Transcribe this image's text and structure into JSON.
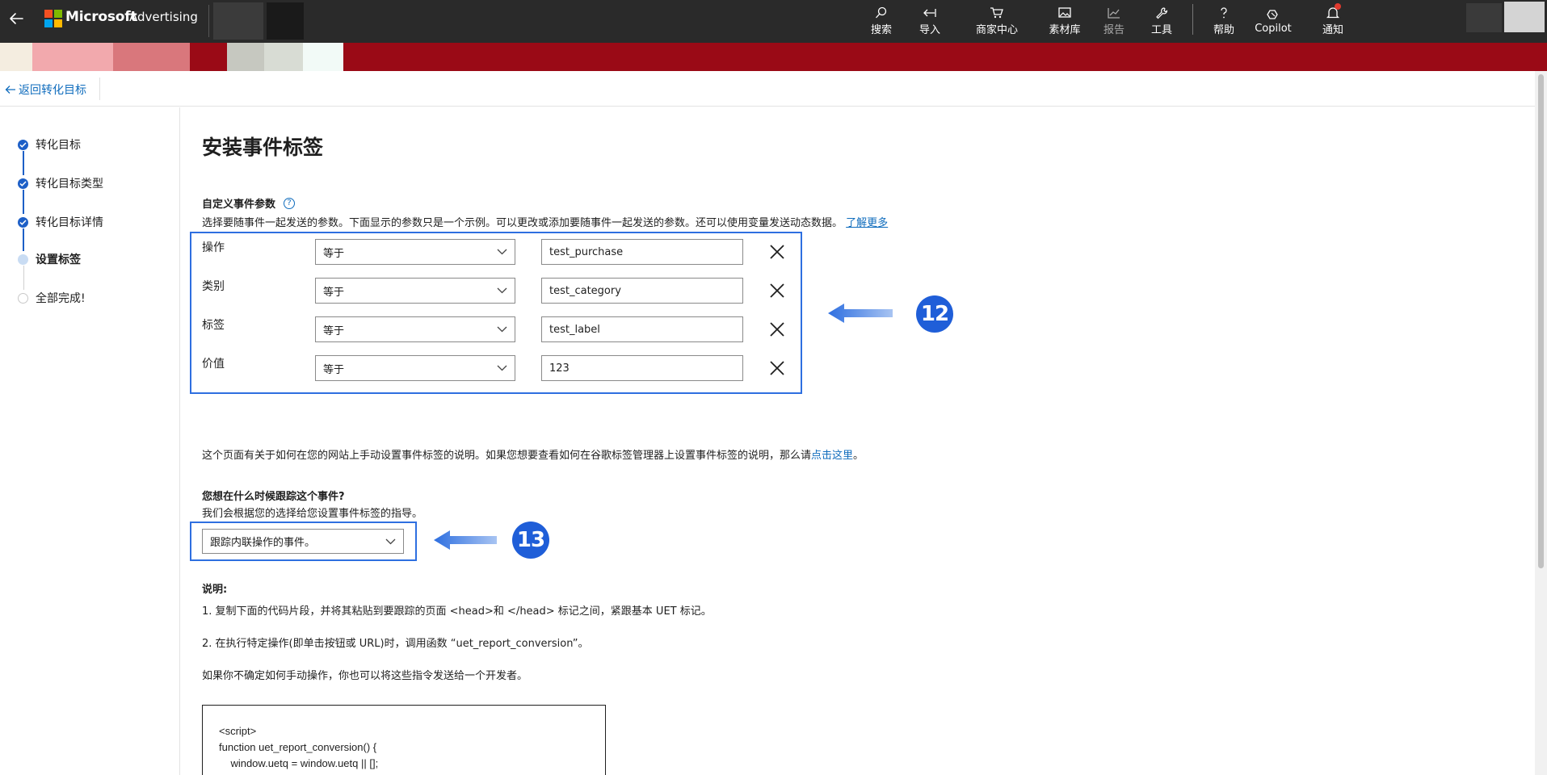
{
  "topbar": {
    "brand_ms": "Microsoft",
    "brand_advertising": "Advertising",
    "nav": [
      {
        "label": "搜索",
        "icon": "search-icon"
      },
      {
        "label": "导入",
        "icon": "import-icon"
      },
      {
        "label": "商家中心",
        "icon": "cart-icon"
      },
      {
        "label": "素材库",
        "icon": "image-library-icon"
      },
      {
        "label": "报告",
        "icon": "chart-icon"
      },
      {
        "label": "工具",
        "icon": "wrench-icon"
      },
      {
        "label": "帮助",
        "icon": "help-icon"
      },
      {
        "label": "Copilot",
        "icon": "copilot-icon"
      },
      {
        "label": "通知",
        "icon": "bell-icon"
      }
    ]
  },
  "breadcrumb": {
    "back_label": "返回转化目标"
  },
  "stepper": {
    "steps": [
      {
        "label": "转化目标",
        "state": "done"
      },
      {
        "label": "转化目标类型",
        "state": "done"
      },
      {
        "label": "转化目标详情",
        "state": "done"
      },
      {
        "label": "设置标签",
        "state": "current"
      },
      {
        "label": "全部完成!",
        "state": "todo"
      }
    ]
  },
  "main": {
    "title": "安装事件标签",
    "custom_params": {
      "label": "自定义事件参数",
      "description": "选择要随事件一起发送的参数。下面显示的参数只是一个示例。可以更改或添加要随事件一起发送的参数。还可以使用变量发送动态数据。",
      "learn_more": "了解更多",
      "rows": [
        {
          "name": "操作",
          "operator": "等于",
          "value": "test_purchase"
        },
        {
          "name": "类别",
          "operator": "等于",
          "value": "test_category"
        },
        {
          "name": "标签",
          "operator": "等于",
          "value": "test_label"
        },
        {
          "name": "价值",
          "operator": "等于",
          "value": "123"
        }
      ]
    },
    "annotations": {
      "badge_12": "12",
      "badge_13": "13"
    },
    "gtm_note": {
      "prefix": "这个页面有关于如何在您的网站上手动设置事件标签的说明。如果您想要查看如何在谷歌标签管理器上设置事件标签的说明，那么请",
      "link": "点击这里",
      "suffix": "。"
    },
    "track_question": {
      "label": "您想在什么时候跟踪这个事件?",
      "hint": "我们会根据您的选择给您设置事件标签的指导。",
      "selected": "跟踪内联操作的事件。"
    },
    "instructions": {
      "label": "说明:",
      "step1": "1. 复制下面的代码片段，并将其粘贴到要跟踪的页面 <head>和 </head> 标记之间，紧跟基本 UET 标记。",
      "step2": "2. 在执行特定操作(即单击按钮或 URL)时，调用函数 “uet_report_conversion”。",
      "note": "如果你不确定如何手动操作，你也可以将这些指令发送给一个开发者。"
    },
    "code": {
      "line1": "<script>",
      "line2": "function uet_report_conversion() {",
      "line3": "    window.uetq = window.uetq || [];"
    }
  },
  "colors": {
    "topbar": "#2a2a2a",
    "banner": "#9a0a16",
    "accent": "#0f6cbd",
    "highlight": "#2e6fe0",
    "badge": "#1f5ed8"
  }
}
